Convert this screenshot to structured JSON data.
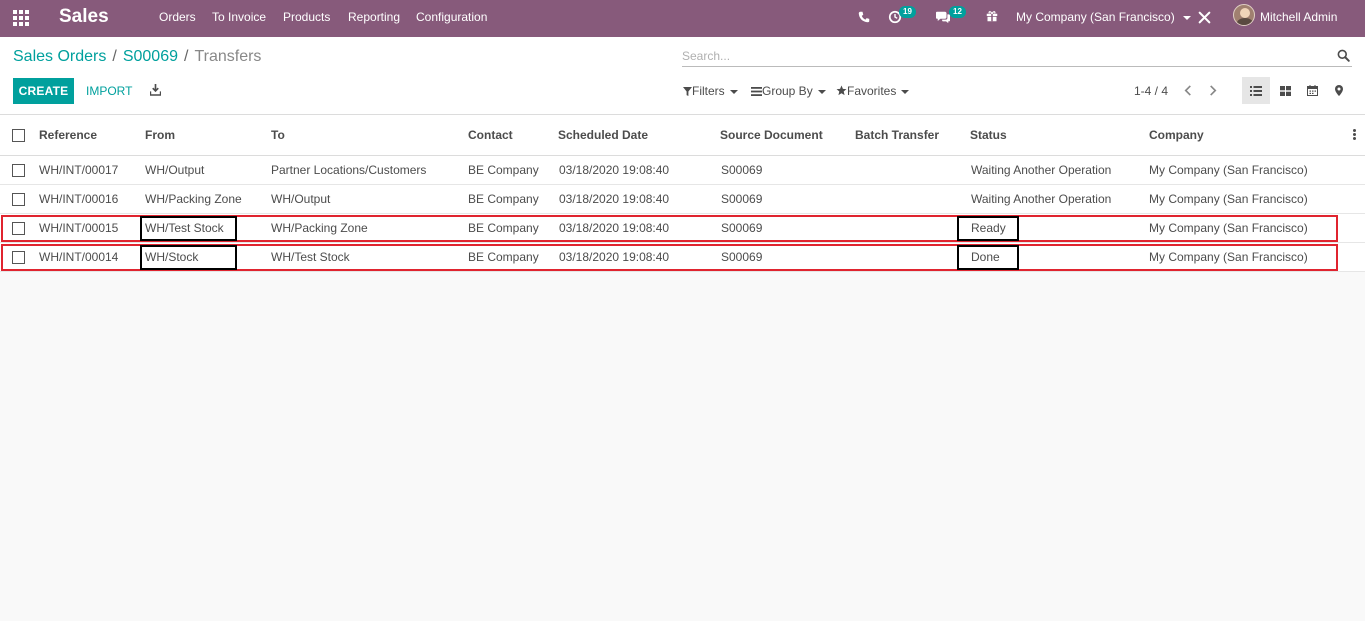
{
  "navbar": {
    "app_title": "Sales",
    "menu": [
      "Orders",
      "To Invoice",
      "Products",
      "Reporting",
      "Configuration"
    ],
    "activity_count": "19",
    "message_count": "12",
    "company": "My Company (San Francisco)",
    "user": "Mitchell Admin",
    "icons": [
      "apps-icon",
      "phone-icon",
      "activity-clock-icon",
      "chat-icon",
      "gift-icon",
      "tools-icon"
    ],
    "color": "#875a7b"
  },
  "breadcrumb": {
    "root": "Sales Orders",
    "order": "S00069",
    "current": "Transfers"
  },
  "search": {
    "placeholder": "Search..."
  },
  "toolbar": {
    "create_label": "CREATE",
    "import_label": "IMPORT",
    "filters_label": "Filters",
    "group_by_label": "Group By",
    "favorites_label": "Favorites",
    "pager": "1-4 / 4",
    "accent_color": "#00a09d"
  },
  "table": {
    "headers": [
      "Reference",
      "From",
      "To",
      "Contact",
      "Scheduled Date",
      "Source Document",
      "Batch Transfer",
      "Status",
      "Company"
    ],
    "rows": [
      [
        "WH/INT/00017",
        "WH/Output",
        "Partner Locations/Customers",
        "BE Company",
        "03/18/2020 19:08:40",
        "S00069",
        "",
        "Waiting Another Operation",
        "My Company (San Francisco)"
      ],
      [
        "WH/INT/00016",
        "WH/Packing Zone",
        "WH/Output",
        "BE Company",
        "03/18/2020 19:08:40",
        "S00069",
        "",
        "Waiting Another Operation",
        "My Company (San Francisco)"
      ],
      [
        "WH/INT/00015",
        "WH/Test Stock",
        "WH/Packing Zone",
        "BE Company",
        "03/18/2020 19:08:40",
        "S00069",
        "",
        "Ready",
        "My Company (San Francisco)"
      ],
      [
        "WH/INT/00014",
        "WH/Stock",
        "WH/Test Stock",
        "BE Company",
        "03/18/2020 19:08:40",
        "S00069",
        "",
        "Done",
        "My Company (San Francisco)"
      ]
    ],
    "highlight_color": "#e0242f"
  }
}
